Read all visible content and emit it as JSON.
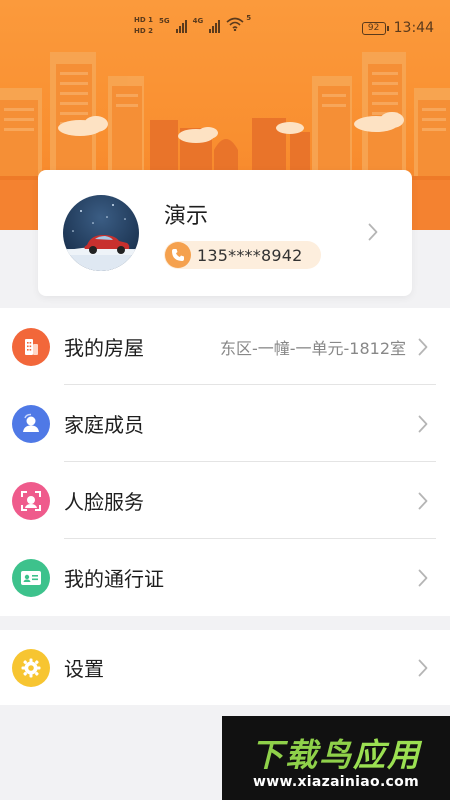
{
  "status_bar": {
    "hd_top": "HD 1",
    "hd_bottom": "HD 2",
    "net1": "5G",
    "net2": "4G",
    "wifi_badge": "5",
    "battery": "92",
    "time": "13:44"
  },
  "profile": {
    "name": "演示",
    "phone": "135****8942"
  },
  "menu_group_1": [
    {
      "label": "我的房屋",
      "value": "东区-一幢-一单元-1812室",
      "icon": "house-icon",
      "color": "#f2673a"
    },
    {
      "label": "家庭成员",
      "value": "",
      "icon": "family-member-icon",
      "color": "#4f79e6"
    },
    {
      "label": "人脸服务",
      "value": "",
      "icon": "face-scan-icon",
      "color": "#ef5b8c"
    },
    {
      "label": "我的通行证",
      "value": "",
      "icon": "id-card-icon",
      "color": "#3dc28c"
    }
  ],
  "menu_group_2": [
    {
      "label": "设置",
      "value": "",
      "icon": "settings-icon",
      "color": "#f7c531"
    }
  ],
  "watermark": {
    "title_part1": "下载鸟",
    "title_part2": "应用",
    "url": "www.xiazainiao.com"
  },
  "colors": {
    "header_orange": "#f98f30",
    "pill_bg": "#fdeedd",
    "phone_icon": "#f5a14e"
  }
}
